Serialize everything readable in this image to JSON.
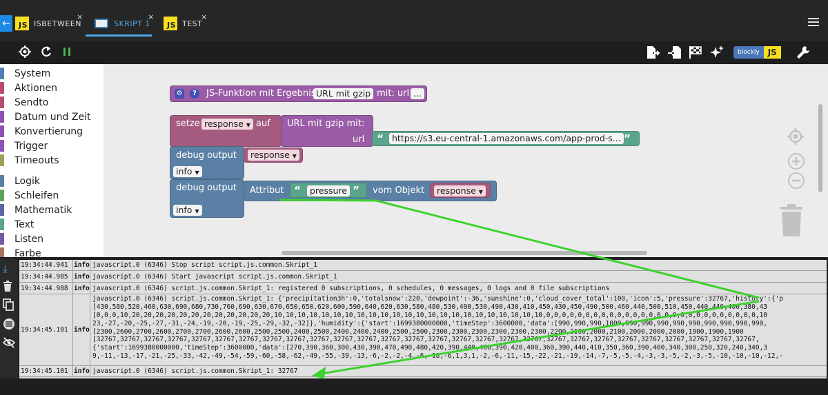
{
  "tabs": [
    {
      "label": "ISBETWEEN",
      "icon": "js-icon",
      "active": false
    },
    {
      "label": "SKRIPT 1",
      "icon": "blockly-icon",
      "active": true
    },
    {
      "label": "TEST",
      "icon": "js-icon",
      "active": false
    }
  ],
  "tab_close": "×",
  "tab_js_text": "JS",
  "toolbar": {
    "blockly_badge": "blockly",
    "js_badge": "JS",
    "icons": [
      "target-icon",
      "reload-icon",
      "pause-icon",
      "export-icon",
      "import-icon",
      "flag-icon",
      "sparkle-icon",
      "blockly-js-toggle",
      "wrench-icon"
    ]
  },
  "sidebar": {
    "items": [
      {
        "label": "System",
        "color": "#4e7fb6"
      },
      {
        "label": "Aktionen",
        "color": "#b54d78"
      },
      {
        "label": "Sendto",
        "color": "#b54d78"
      },
      {
        "label": "Datum und Zeit",
        "color": "#8d52b3"
      },
      {
        "label": "Konvertierung",
        "color": "#8d52b3"
      },
      {
        "label": "Trigger",
        "color": "#8d52b3"
      },
      {
        "label": "Timeouts",
        "color": "#9fa055"
      },
      {
        "label": "Logik",
        "color": "#5b80a5"
      },
      {
        "label": "Schleifen",
        "color": "#5ba55b"
      },
      {
        "label": "Mathematik",
        "color": "#5b67a5"
      },
      {
        "label": "Text",
        "color": "#5ba58c"
      },
      {
        "label": "Listen",
        "color": "#745ba5"
      },
      {
        "label": "Farbe",
        "color": "#a5745b"
      }
    ]
  },
  "blocks": {
    "function_def": {
      "label": "JS-Funktion mit Ergebnis",
      "name": "URL mit gzip",
      "mit": "mit: url",
      "more": "..."
    },
    "setze": {
      "label": "setze",
      "var": "response",
      "auf": "auf",
      "call_label": "URL mit gzip  mit:",
      "url_label": "url",
      "url_value": "https://s3.eu-central-1.amazonaws.com/app-prod-s..."
    },
    "debug1": {
      "label": "debug output",
      "var": "response",
      "level": "info"
    },
    "debug2": {
      "label": "debug output",
      "attr_label": "Attribut",
      "attr_value": "pressure",
      "vom_objekt": "vom Objekt",
      "obj": "response",
      "level": "info"
    }
  },
  "colors": {
    "procedure": "#9a5ca6",
    "variable": "#a55b80",
    "debug": "#5b80a5",
    "text": "#5ba58c",
    "arrow": "#3ed12f"
  },
  "log": {
    "rows": [
      {
        "time": "19:34:44.941",
        "level": "info",
        "lines": [
          "javascript.0 (6346) Stop script script.js.common.Skript_1"
        ]
      },
      {
        "time": "19:34:44.985",
        "level": "info",
        "lines": [
          "javascript.0 (6346) Start javascript script.js.common.Skript_1"
        ]
      },
      {
        "time": "19:34:44.988",
        "level": "info",
        "lines": [
          "javascript.0 (6346) script.js.common.Skript_1: registered 0 subscriptions, 0 schedules, 0 messages, 0 logs and 0 file subscriptions"
        ]
      },
      {
        "time": "19:34:45.101",
        "level": "info",
        "lines": [
          "javascript.0 (6346) script.js.common.Skript_1: {'precipitation3h':0,'totalsnow':220,'dewpoint':-36,'sunshine':0,'cloud_cover_total':100,'icon':5,'pressure':32767,'history':{'p",
          "[430,580,520,460,630,690,680,730,760,690,630,670,650,650,620,600,590,640,620,630,580,480,530,490,530,490,430,410,450,430,450,490,500,460,440,500,510,450,440,440,400,380,43",
          "[0,0,0,10,20,20,20,20,20,20,20,20,20,20,20,20,10,10,10,10,10,10,10,10,10,10,10,10,10,10,10,10,10,10,10,10,10,10,10,0,0,0,0,0,0,0,0,0,0,0,0,0,0,0,0,0,0,0,0,0,0,0,0,0,0,0,10",
          "23,-27,-20,-25,-27,-31,-24,-19,-20,-19,-25,-29,-32,-32]},'humidity':{'start':1699380000000,'timeStep':3600000,'data':[990,990,990,1000,990,990,990,990,990,990,990,990,990,",
          "[2300,2600,2700,2600,2700,2700,2600,2600,2500,2500,2400,2500,2400,2400,2400,2500,2500,2300,2300,2300,2300,2300,2300,2200,2100,2000,2100,2000,2000,2000,1900,1900,1900",
          "[32767,32767,32767,32767,32767,32767,32767,32767,32767,32767,32767,32767,32767,32767,32767,32767,32767,32767,32767,32767,32767,32767,32767,32767,32767,32767,32767,32767,",
          "{'start':1699380000000,'timeStep':3600000,'data':[270,390,360,300,430,390,470,490,480,420,390,440,400,390,420,400,360,390,440,410,350,360,390,400,340,300,250,320,240,340,3",
          "9,-11,-13,-17,-21,-25,-33,-42,-49,-54,-59,-60,-58,-62,-49,-55,-39,-13,-6,-2,-2,-4,-6,-18,-6,1,3,1,-2,-6,-11,-15,-22,-21,-19,-14,-7,-5,-5,-4,-3,-3,-5,-2,-3,-5,-10,-10,-10,-12,-"
        ]
      },
      {
        "time": "19:34:45.101",
        "level": "info",
        "lines": [
          "javascript.0 (6346) script.js.common.Skript_1: 32767"
        ]
      }
    ]
  }
}
